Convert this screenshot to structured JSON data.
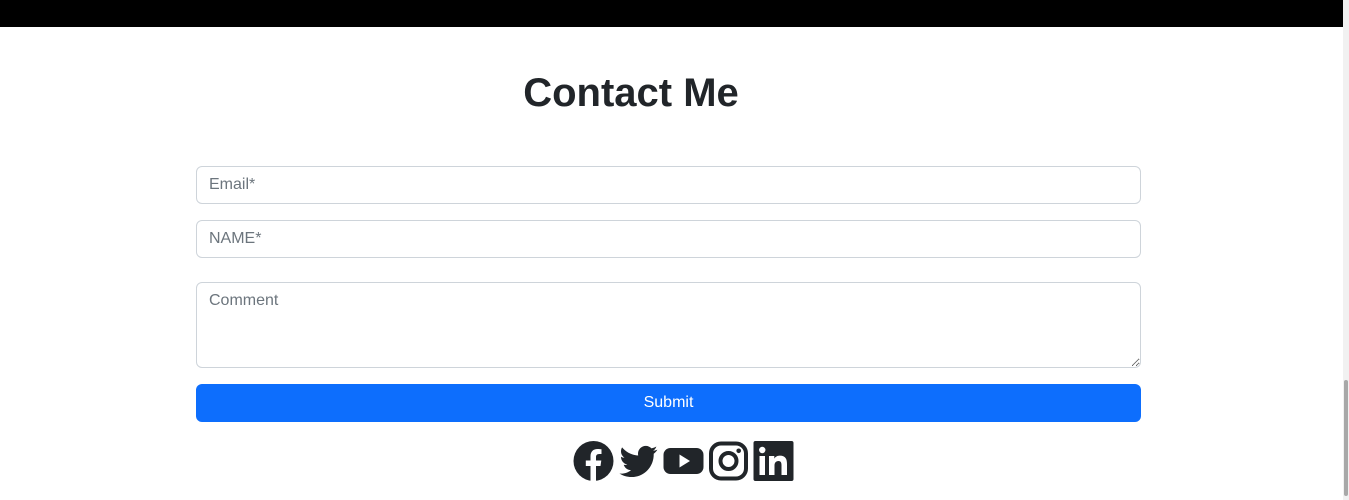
{
  "header": {
    "bar_color": "#000000"
  },
  "contact": {
    "title": "Contact Me",
    "email_placeholder": "Email*",
    "name_placeholder": "NAME*",
    "comment_placeholder": "Comment",
    "submit_label": "Submit",
    "submit_color": "#0d6efd"
  },
  "socials": [
    {
      "icon": "facebook-icon"
    },
    {
      "icon": "twitter-icon"
    },
    {
      "icon": "youtube-icon"
    },
    {
      "icon": "instagram-icon"
    },
    {
      "icon": "linkedin-icon"
    }
  ]
}
